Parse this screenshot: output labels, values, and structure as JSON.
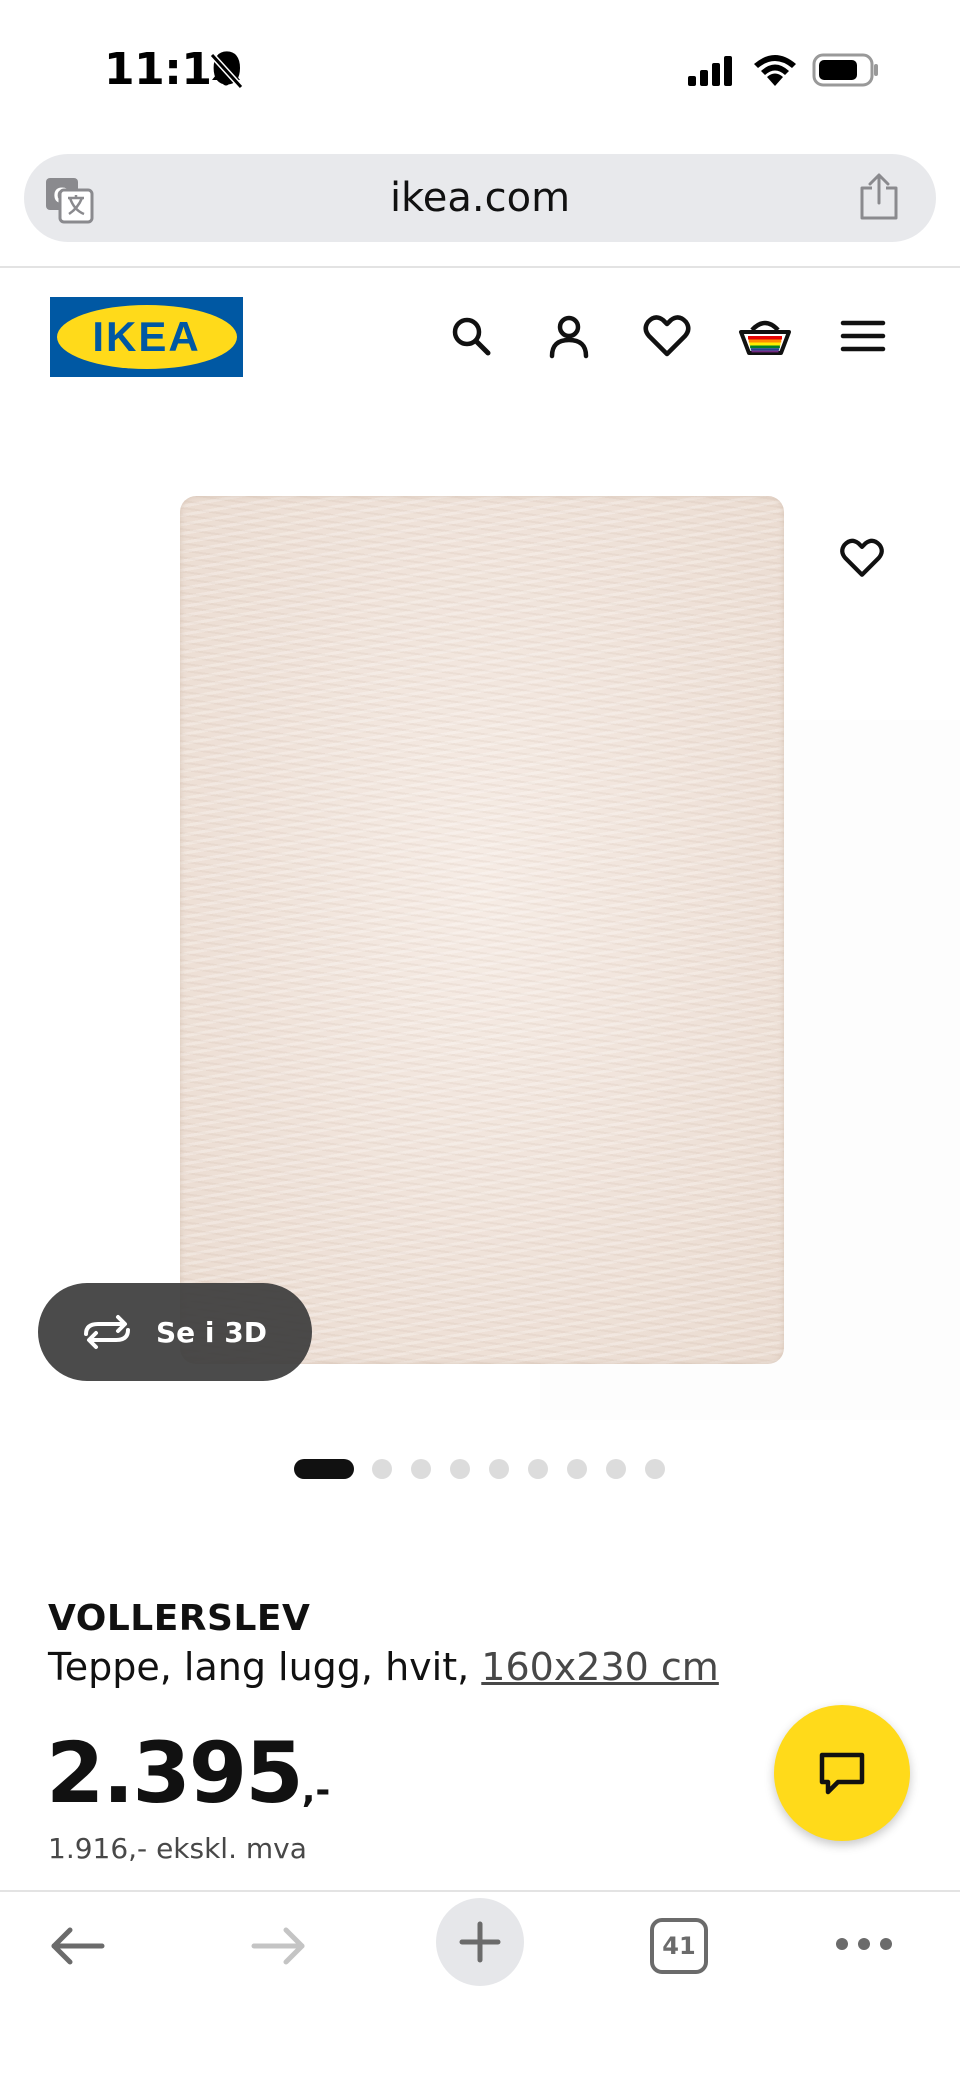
{
  "status_bar": {
    "time": "11:10",
    "icons": [
      "bell-off-icon",
      "cellular-signal-icon",
      "wifi-icon",
      "battery-icon"
    ]
  },
  "browser": {
    "url": "ikea.com",
    "icons": [
      "translate-icon",
      "share-icon"
    ]
  },
  "header": {
    "logo_text": "IKEA",
    "icons": [
      "search-icon",
      "account-icon",
      "favorites-icon",
      "basket-icon",
      "menu-icon"
    ]
  },
  "gallery": {
    "see_3d_label": "Se i 3D",
    "image_count": 9,
    "active_index": 0
  },
  "product": {
    "name": "VOLLERSLEV",
    "description": "Teppe, lang lugg, hvit, ",
    "size": "160x230 cm",
    "price_main": "2.395",
    "price_suffix": ",-",
    "price_ex_vat": "1.916,- ekskl. mva"
  },
  "chat": {
    "icon": "chat-icon"
  },
  "bottom_bar": {
    "tabs_count": "41",
    "icons": [
      "back-icon",
      "forward-icon",
      "new-tab-icon",
      "tabs-icon",
      "more-icon"
    ]
  },
  "colors": {
    "ikea_blue": "#0058a3",
    "ikea_yellow": "#ffda1a",
    "text": "#111111",
    "muted_text": "#484848"
  }
}
